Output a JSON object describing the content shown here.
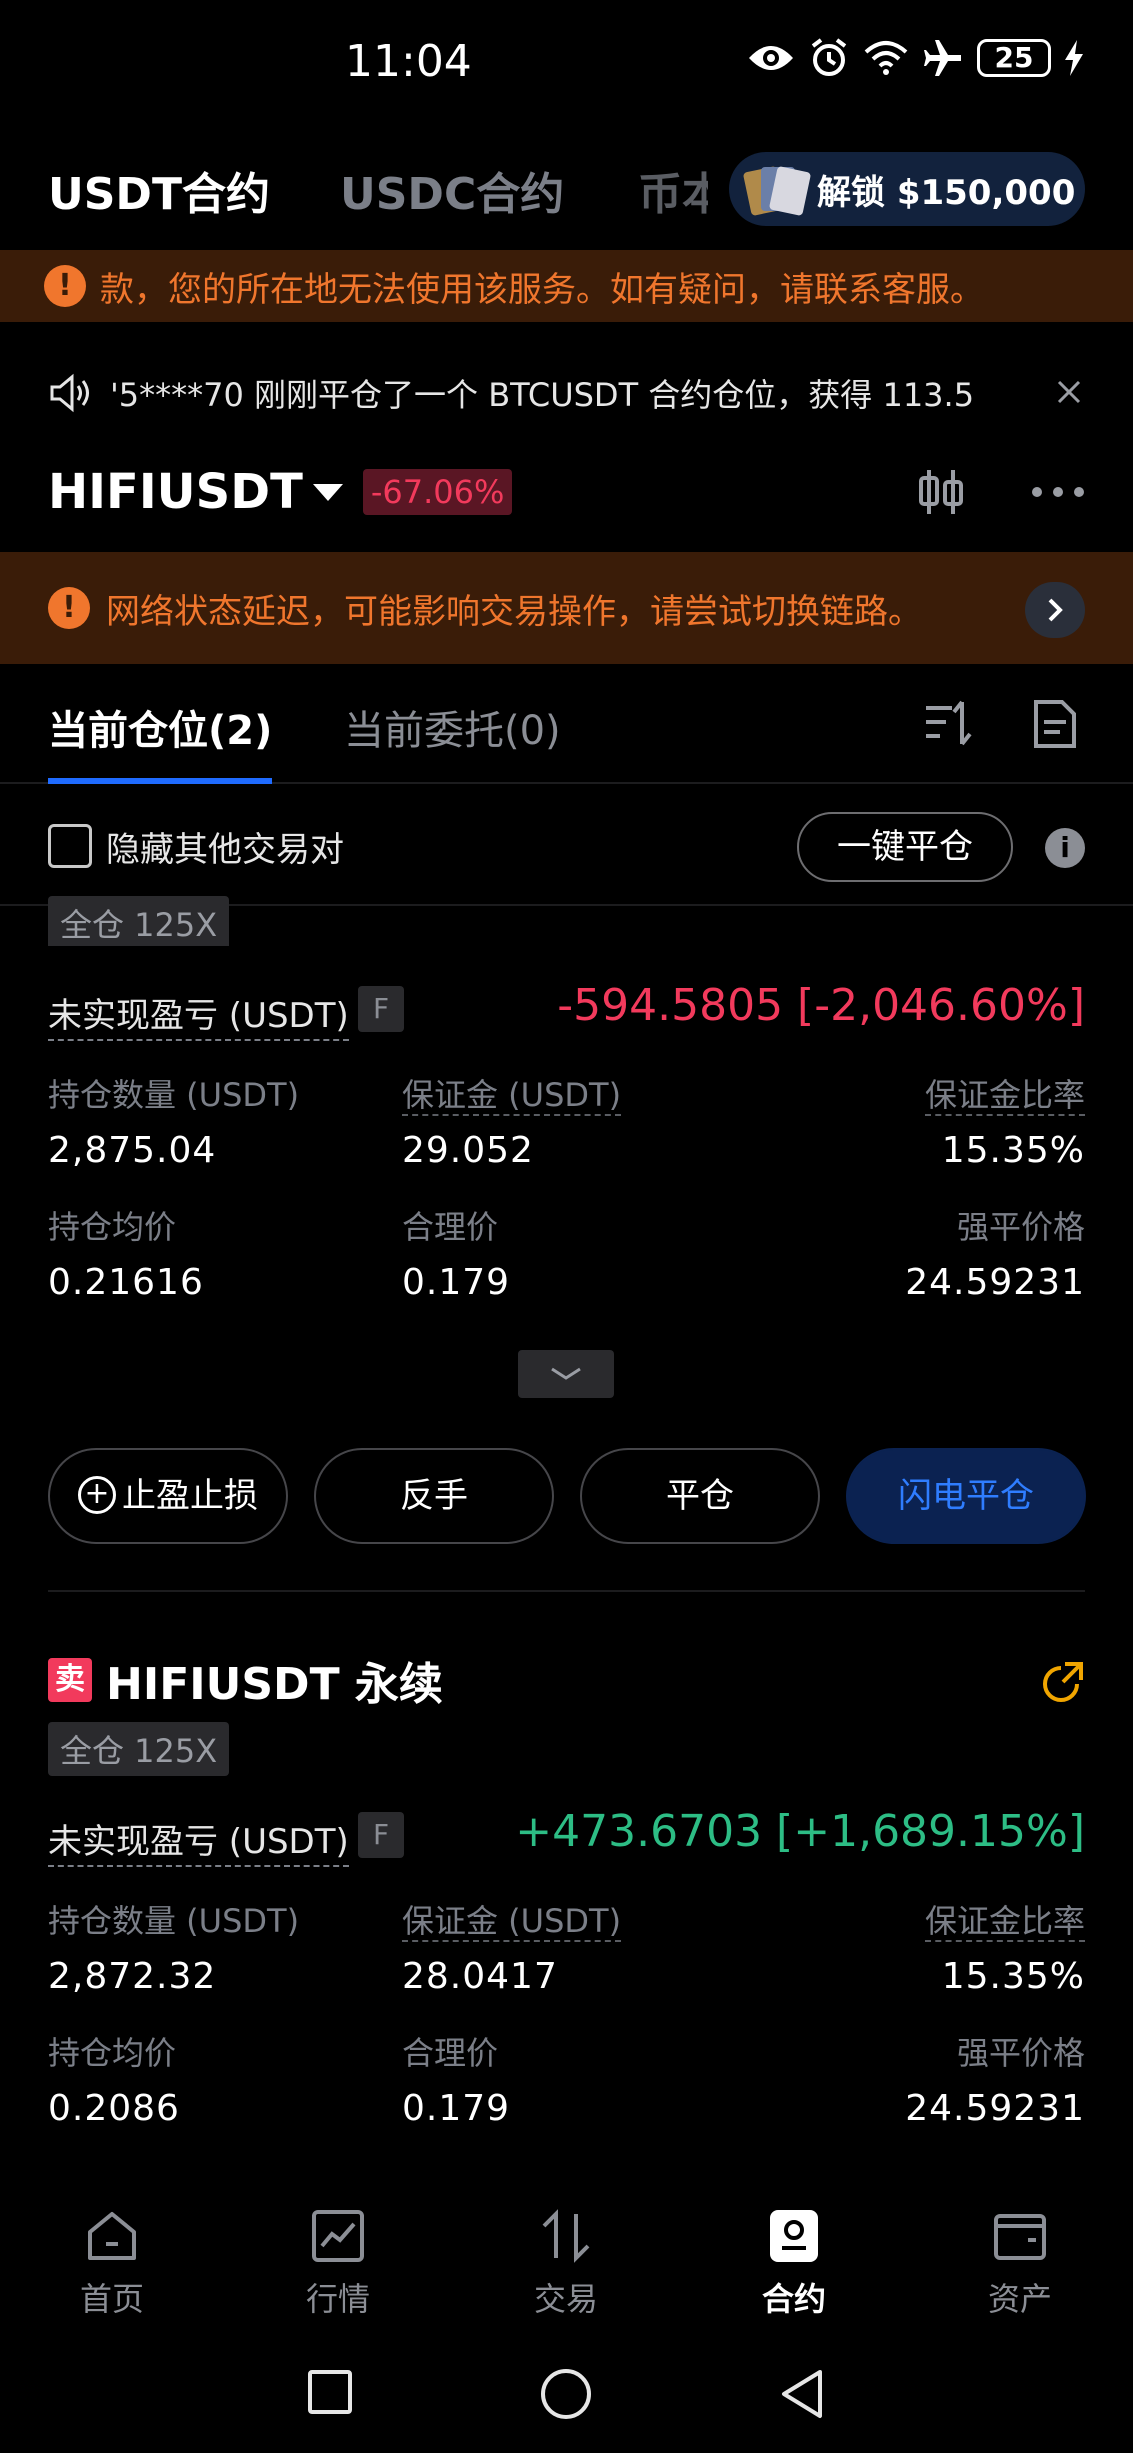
{
  "status_bar": {
    "time": "11:04",
    "battery": "25",
    "icons": [
      "eye-icon",
      "alarm-icon",
      "wifi-icon",
      "airplane-icon",
      "battery-icon",
      "charging-icon"
    ]
  },
  "contract_tabs": {
    "items": [
      "USDT合约",
      "USDC合约",
      "币本"
    ],
    "active": "USDT合约",
    "unlock_label": "解锁 $150,000"
  },
  "region_warning": {
    "text": "款，您的所在地无法使用该服务。如有疑问，请联系客服。",
    "color": "#f0762d"
  },
  "announcement": {
    "text": "'5****70 刚刚平仓了一个 BTCUSDT 合约仓位，获得 113.5"
  },
  "pair": {
    "name": "HIFIUSDT",
    "change": "-67.06%"
  },
  "network_warning": {
    "text": "网络状态延迟，可能影响交易操作，请尝试切换链路。"
  },
  "position_tabs": {
    "current_positions": "当前仓位(2)",
    "open_orders": "当前委托(0)"
  },
  "filter": {
    "hide_other_pairs": "隐藏其他交易对",
    "close_all": "一键平仓"
  },
  "positions": [
    {
      "mode": "全仓 125X",
      "pnl_label": "未实现盈亏 (USDT)",
      "f_badge": "F",
      "pnl_value": "-594.5805 [-2,046.60%]",
      "size_label": "持仓数量 (USDT)",
      "size_value": "2,875.04",
      "margin_label": "保证金 (USDT)",
      "margin_value": "29.052",
      "margin_ratio_label": "保证金比率",
      "margin_ratio_value": "15.35%",
      "entry_label": "持仓均价",
      "entry_value": "0.21616",
      "fair_label": "合理价",
      "fair_value": "0.179",
      "liq_label": "强平价格",
      "liq_value": "24.59231"
    },
    {
      "side": "卖",
      "symbol": "HIFIUSDT 永续",
      "mode": "全仓 125X",
      "pnl_label": "未实现盈亏 (USDT)",
      "f_badge": "F",
      "pnl_value": "+473.6703 [+1,689.15%]",
      "size_label": "持仓数量 (USDT)",
      "size_value": "2,872.32",
      "margin_label": "保证金 (USDT)",
      "margin_value": "28.0417",
      "margin_ratio_label": "保证金比率",
      "margin_ratio_value": "15.35%",
      "entry_label": "持仓均价",
      "entry_value": "0.2086",
      "fair_label": "合理价",
      "fair_value": "0.179",
      "liq_label": "强平价格",
      "liq_value": "24.59231"
    }
  ],
  "actions": {
    "tp_sl": "止盈止损",
    "reverse": "反手",
    "close": "平仓",
    "flash_close": "闪电平仓"
  },
  "bottom_nav": [
    {
      "label": "首页",
      "icon": "home-icon"
    },
    {
      "label": "行情",
      "icon": "chart-icon"
    },
    {
      "label": "交易",
      "icon": "trade-arrows-icon"
    },
    {
      "label": "合约",
      "icon": "contract-icon",
      "active": true
    },
    {
      "label": "资产",
      "icon": "wallet-icon"
    }
  ],
  "colors": {
    "negative": "#f23a5c",
    "positive": "#2dbd85",
    "accent": "#1f6bff",
    "warning": "#f0762d"
  }
}
